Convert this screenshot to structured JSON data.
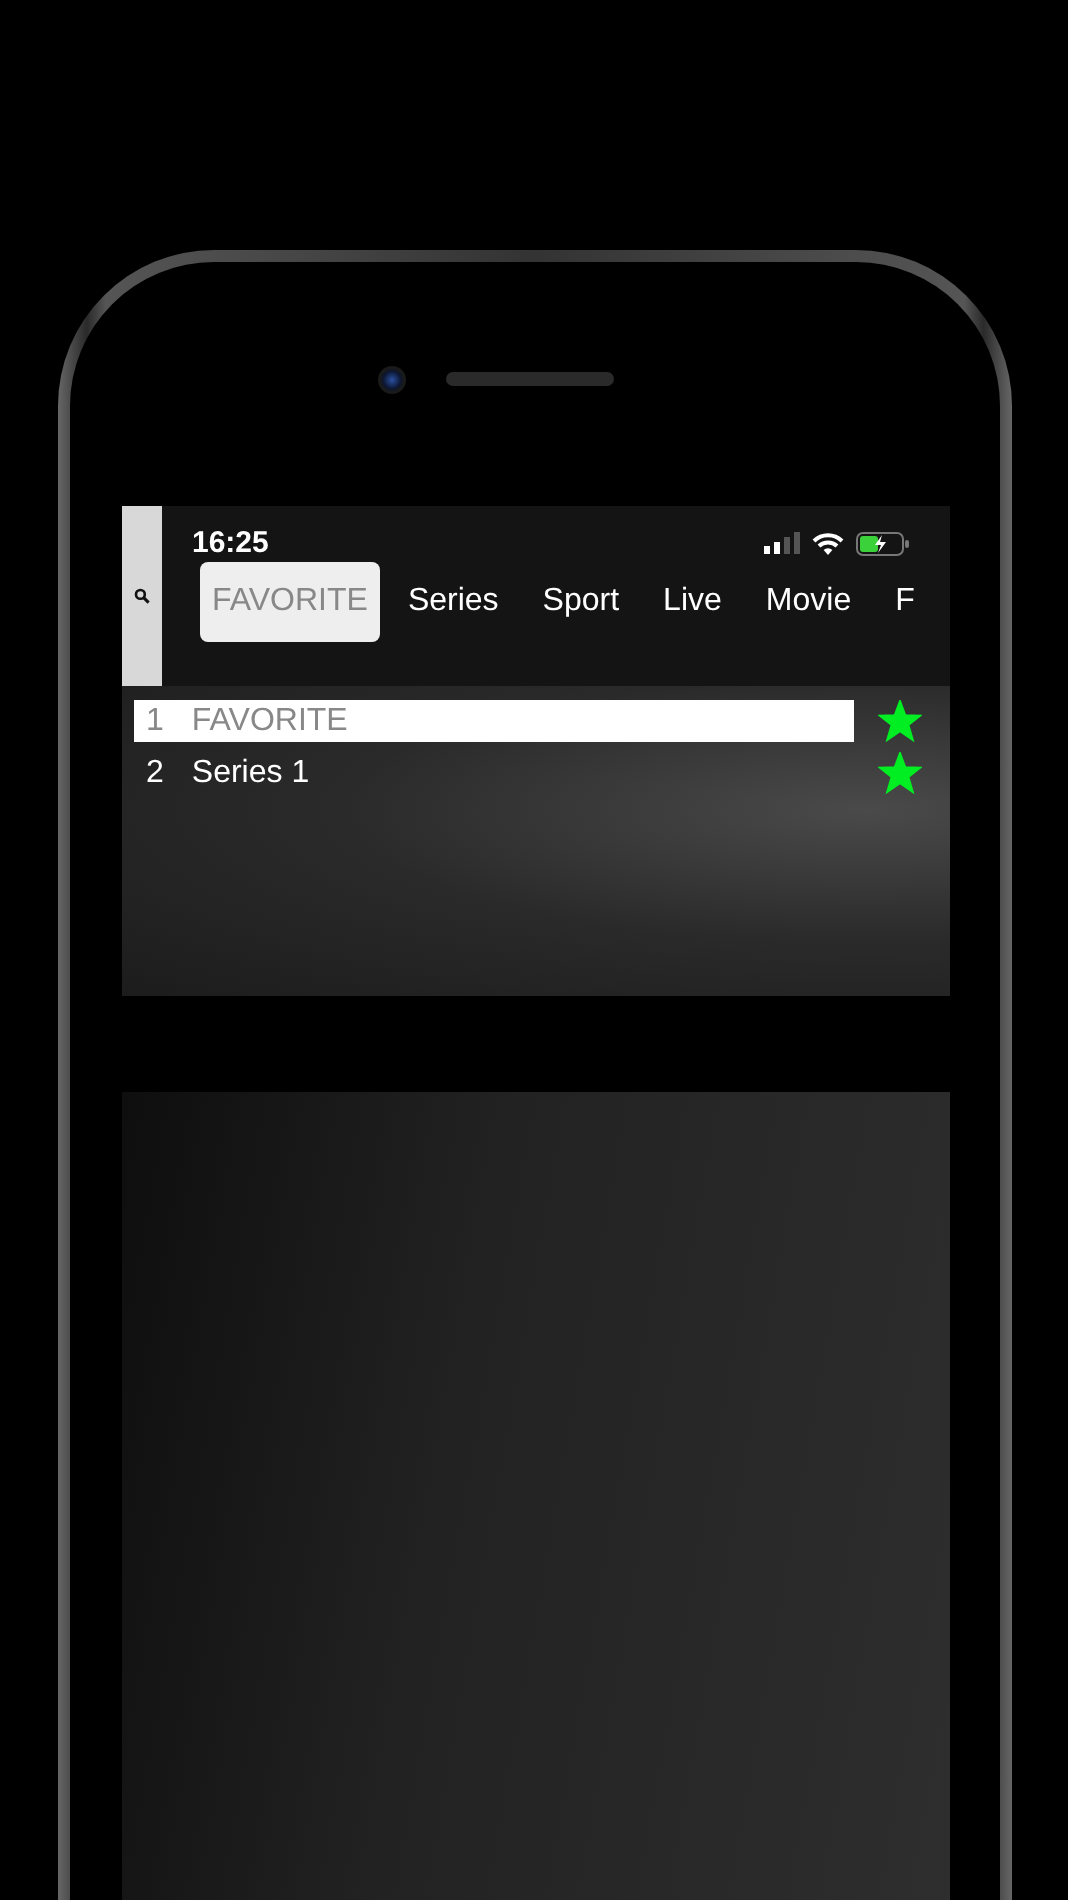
{
  "status_bar": {
    "time": "16:25"
  },
  "tabs": [
    {
      "label": "FAVORITE",
      "selected": true
    },
    {
      "label": "Series",
      "selected": false
    },
    {
      "label": "Sport",
      "selected": false
    },
    {
      "label": "Live",
      "selected": false
    },
    {
      "label": "Movie",
      "selected": false
    },
    {
      "label": "F",
      "selected": false
    }
  ],
  "list": [
    {
      "number": "1",
      "name": "FAVORITE",
      "selected": true,
      "starred": true
    },
    {
      "number": "2",
      "name": "Series 1",
      "selected": false,
      "starred": true
    }
  ]
}
